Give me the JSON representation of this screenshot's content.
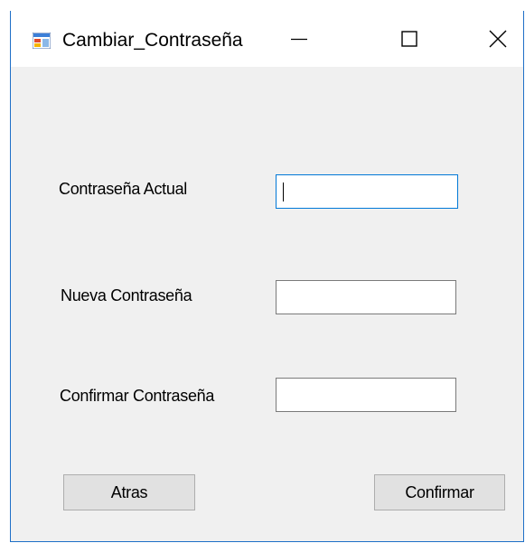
{
  "window": {
    "title": "Cambiar_Contraseña",
    "icon": "windows-form-icon",
    "controls": {
      "minimize": "minimize-icon",
      "maximize": "maximize-icon",
      "close": "close-icon"
    },
    "accent_color": "#0078d7"
  },
  "form": {
    "current_password_label": "Contraseña Actual",
    "current_password_value": "",
    "new_password_label": "Nueva Contraseña",
    "new_password_value": "",
    "confirm_password_label": "Confirmar Contraseña",
    "confirm_password_value": ""
  },
  "buttons": {
    "back_label": "Atras",
    "confirm_label": "Confirmar"
  }
}
